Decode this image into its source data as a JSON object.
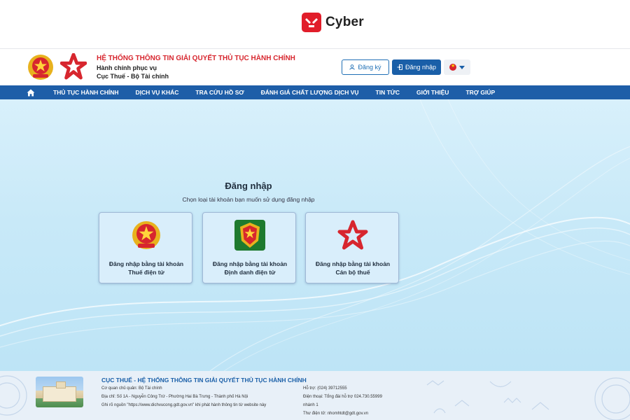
{
  "brand": {
    "name": "Cyber",
    "logo_icon": "tools-icon",
    "logo_color": "#e11d2a"
  },
  "header": {
    "title": "HỆ THỐNG THÔNG TIN GIẢI QUYẾT THỦ TỤC HÀNH CHÍNH",
    "subtitle1": "Hành chính phục vụ",
    "subtitle2": "Cục Thuế - Bộ Tài chính",
    "register_label": "Đăng ký",
    "login_label": "Đăng nhập",
    "language_icon": "vietnam-flag-icon"
  },
  "nav": {
    "items": [
      "THỦ TỤC HÀNH CHÍNH",
      "DỊCH VỤ KHÁC",
      "TRA CỨU HỒ SƠ",
      "ĐÁNH GIÁ CHẤT LƯỢNG DỊCH VỤ",
      "TIN TỨC",
      "GIỚI THIỆU",
      "TRỢ GIÚP"
    ]
  },
  "login": {
    "title": "Đăng nhập",
    "subtitle": "Chọn loại tài khoản bạn muốn sử dụng đăng nhập",
    "options": [
      {
        "line1": "Đăng nhập bằng tài khoản",
        "line2": "Thuế điện tử",
        "icon": "national-emblem-icon"
      },
      {
        "line1": "Đăng nhập bằng tài khoản",
        "line2": "Định danh điện tử",
        "icon": "police-badge-icon"
      },
      {
        "line1": "Đăng nhập bằng tài khoản",
        "line2": "Cán bộ thuế",
        "icon": "star-logo-icon"
      }
    ]
  },
  "footer": {
    "title": "CỤC THUẾ - HỆ THỐNG THÔNG TIN GIẢI QUYẾT THỦ TỤC HÀNH CHÍNH",
    "agency": "Cơ quan chủ quản: Bộ Tài chính",
    "address": "Địa chỉ: Số 1A - Nguyễn Công Trứ - Phường Hai Bà Trưng - Thành phố Hà Nội",
    "source_note": "Ghi rõ nguồn \"https://www.dichvucong.gdt.gov.vn\" khi phát hành thông tin từ website này",
    "support": "Hỗ trợ: (024) 39712555",
    "phone": "Điện thoại: Tổng đài hỗ trợ 024.730.55999",
    "phone_cont": "nhánh 1",
    "email": "Thư điện tử: nhomhtdt@gdt.gov.vn"
  },
  "colors": {
    "primary_blue": "#1e5ea8",
    "accent_red": "#d7262e"
  }
}
